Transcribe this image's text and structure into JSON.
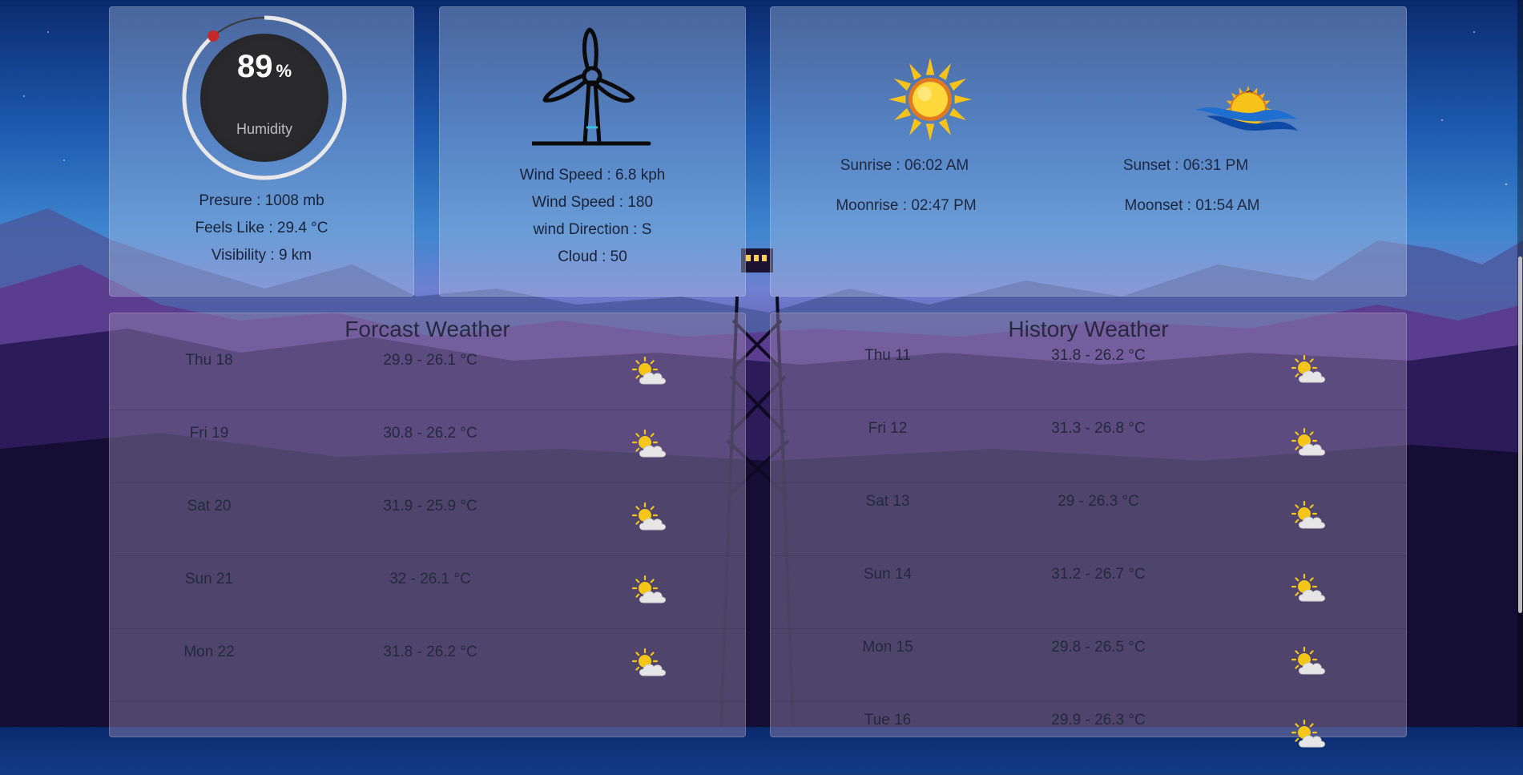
{
  "humidity_card": {
    "value": "89",
    "unit": "%",
    "label": "Humidity",
    "level": 0.89,
    "pressure": "Presure : 1008 mb",
    "feels_like": "Feels Like : 29.4 °C",
    "visibility": "Visibility : 9 km"
  },
  "wind_card": {
    "wind_speed": "Wind Speed : 6.8 kph",
    "wind_degree": "Wind Speed : 180",
    "wind_direction": "wind Direction : S",
    "cloud": "Cloud : 50"
  },
  "astro_card": {
    "sunrise": "Sunrise : 06:02 AM",
    "sunset": "Sunset : 06:31 PM",
    "moonrise": "Moonrise : 02:47 PM",
    "moonset": "Moonset : 01:54 AM"
  },
  "forecast": {
    "title": "Forcast Weather",
    "rows": [
      {
        "day": "Thu 18",
        "temp": "29.9 - 26.1 °C",
        "icon": "partly-sunny-icon"
      },
      {
        "day": "Fri 19",
        "temp": "30.8 - 26.2 °C",
        "icon": "partly-sunny-icon"
      },
      {
        "day": "Sat 20",
        "temp": "31.9 - 25.9 °C",
        "icon": "partly-sunny-icon"
      },
      {
        "day": "Sun 21",
        "temp": "32 - 26.1 °C",
        "icon": "partly-sunny-icon"
      },
      {
        "day": "Mon 22",
        "temp": "31.8 - 26.2 °C",
        "icon": "partly-sunny-icon"
      }
    ]
  },
  "history": {
    "title": "History Weather",
    "rows": [
      {
        "day": "Thu 11",
        "temp": "31.8 - 26.2 °C",
        "icon": "partly-sunny-icon"
      },
      {
        "day": "Fri 12",
        "temp": "31.3 - 26.8 °C",
        "icon": "partly-sunny-icon"
      },
      {
        "day": "Sat 13",
        "temp": "29 - 26.3 °C",
        "icon": "partly-sunny-icon"
      },
      {
        "day": "Sun 14",
        "temp": "31.2 - 26.7 °C",
        "icon": "partly-sunny-icon"
      },
      {
        "day": "Mon 15",
        "temp": "29.8 - 26.5 °C",
        "icon": "partly-sunny-icon"
      },
      {
        "day": "Tue 16",
        "temp": "29.9 - 26.3 °C",
        "icon": "partly-sunny-icon"
      }
    ]
  },
  "colors": {
    "gauge_track": "#e8e8e8",
    "gauge_marker": "#c62828",
    "gauge_center": "#2a2a2c",
    "sun_yellow": "#f7c21a",
    "sun_ring": "#e0791f",
    "sea_blue": "#1e6fd0"
  }
}
